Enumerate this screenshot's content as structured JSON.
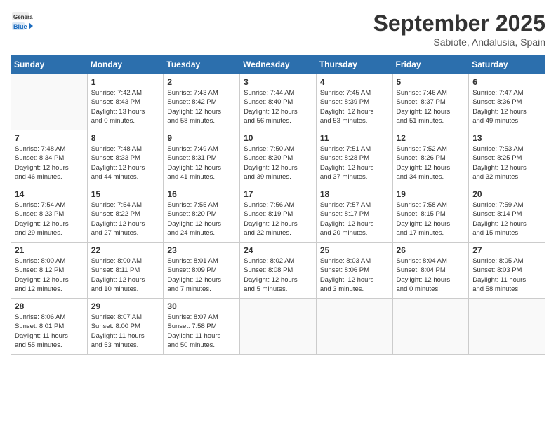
{
  "header": {
    "logo_line1": "General",
    "logo_line2": "Blue",
    "month": "September 2025",
    "location": "Sabiote, Andalusia, Spain"
  },
  "days_of_week": [
    "Sunday",
    "Monday",
    "Tuesday",
    "Wednesday",
    "Thursday",
    "Friday",
    "Saturday"
  ],
  "weeks": [
    [
      {
        "num": "",
        "info": ""
      },
      {
        "num": "1",
        "info": "Sunrise: 7:42 AM\nSunset: 8:43 PM\nDaylight: 13 hours\nand 0 minutes."
      },
      {
        "num": "2",
        "info": "Sunrise: 7:43 AM\nSunset: 8:42 PM\nDaylight: 12 hours\nand 58 minutes."
      },
      {
        "num": "3",
        "info": "Sunrise: 7:44 AM\nSunset: 8:40 PM\nDaylight: 12 hours\nand 56 minutes."
      },
      {
        "num": "4",
        "info": "Sunrise: 7:45 AM\nSunset: 8:39 PM\nDaylight: 12 hours\nand 53 minutes."
      },
      {
        "num": "5",
        "info": "Sunrise: 7:46 AM\nSunset: 8:37 PM\nDaylight: 12 hours\nand 51 minutes."
      },
      {
        "num": "6",
        "info": "Sunrise: 7:47 AM\nSunset: 8:36 PM\nDaylight: 12 hours\nand 49 minutes."
      }
    ],
    [
      {
        "num": "7",
        "info": "Sunrise: 7:48 AM\nSunset: 8:34 PM\nDaylight: 12 hours\nand 46 minutes."
      },
      {
        "num": "8",
        "info": "Sunrise: 7:48 AM\nSunset: 8:33 PM\nDaylight: 12 hours\nand 44 minutes."
      },
      {
        "num": "9",
        "info": "Sunrise: 7:49 AM\nSunset: 8:31 PM\nDaylight: 12 hours\nand 41 minutes."
      },
      {
        "num": "10",
        "info": "Sunrise: 7:50 AM\nSunset: 8:30 PM\nDaylight: 12 hours\nand 39 minutes."
      },
      {
        "num": "11",
        "info": "Sunrise: 7:51 AM\nSunset: 8:28 PM\nDaylight: 12 hours\nand 37 minutes."
      },
      {
        "num": "12",
        "info": "Sunrise: 7:52 AM\nSunset: 8:26 PM\nDaylight: 12 hours\nand 34 minutes."
      },
      {
        "num": "13",
        "info": "Sunrise: 7:53 AM\nSunset: 8:25 PM\nDaylight: 12 hours\nand 32 minutes."
      }
    ],
    [
      {
        "num": "14",
        "info": "Sunrise: 7:54 AM\nSunset: 8:23 PM\nDaylight: 12 hours\nand 29 minutes."
      },
      {
        "num": "15",
        "info": "Sunrise: 7:54 AM\nSunset: 8:22 PM\nDaylight: 12 hours\nand 27 minutes."
      },
      {
        "num": "16",
        "info": "Sunrise: 7:55 AM\nSunset: 8:20 PM\nDaylight: 12 hours\nand 24 minutes."
      },
      {
        "num": "17",
        "info": "Sunrise: 7:56 AM\nSunset: 8:19 PM\nDaylight: 12 hours\nand 22 minutes."
      },
      {
        "num": "18",
        "info": "Sunrise: 7:57 AM\nSunset: 8:17 PM\nDaylight: 12 hours\nand 20 minutes."
      },
      {
        "num": "19",
        "info": "Sunrise: 7:58 AM\nSunset: 8:15 PM\nDaylight: 12 hours\nand 17 minutes."
      },
      {
        "num": "20",
        "info": "Sunrise: 7:59 AM\nSunset: 8:14 PM\nDaylight: 12 hours\nand 15 minutes."
      }
    ],
    [
      {
        "num": "21",
        "info": "Sunrise: 8:00 AM\nSunset: 8:12 PM\nDaylight: 12 hours\nand 12 minutes."
      },
      {
        "num": "22",
        "info": "Sunrise: 8:00 AM\nSunset: 8:11 PM\nDaylight: 12 hours\nand 10 minutes."
      },
      {
        "num": "23",
        "info": "Sunrise: 8:01 AM\nSunset: 8:09 PM\nDaylight: 12 hours\nand 7 minutes."
      },
      {
        "num": "24",
        "info": "Sunrise: 8:02 AM\nSunset: 8:08 PM\nDaylight: 12 hours\nand 5 minutes."
      },
      {
        "num": "25",
        "info": "Sunrise: 8:03 AM\nSunset: 8:06 PM\nDaylight: 12 hours\nand 3 minutes."
      },
      {
        "num": "26",
        "info": "Sunrise: 8:04 AM\nSunset: 8:04 PM\nDaylight: 12 hours\nand 0 minutes."
      },
      {
        "num": "27",
        "info": "Sunrise: 8:05 AM\nSunset: 8:03 PM\nDaylight: 11 hours\nand 58 minutes."
      }
    ],
    [
      {
        "num": "28",
        "info": "Sunrise: 8:06 AM\nSunset: 8:01 PM\nDaylight: 11 hours\nand 55 minutes."
      },
      {
        "num": "29",
        "info": "Sunrise: 8:07 AM\nSunset: 8:00 PM\nDaylight: 11 hours\nand 53 minutes."
      },
      {
        "num": "30",
        "info": "Sunrise: 8:07 AM\nSunset: 7:58 PM\nDaylight: 11 hours\nand 50 minutes."
      },
      {
        "num": "",
        "info": ""
      },
      {
        "num": "",
        "info": ""
      },
      {
        "num": "",
        "info": ""
      },
      {
        "num": "",
        "info": ""
      }
    ]
  ]
}
